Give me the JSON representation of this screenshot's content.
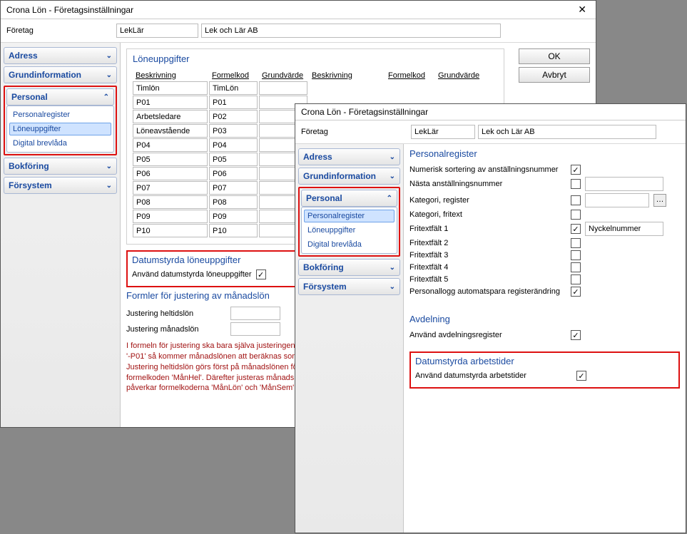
{
  "window_back": {
    "title": "Crona Lön - Företagsinställningar",
    "company_label": "Företag",
    "company_code": "LekLär",
    "company_name": "Lek och Lär AB",
    "buttons": {
      "ok": "OK",
      "cancel": "Avbryt"
    },
    "nav": {
      "adress": "Adress",
      "grundinformation": "Grundinformation",
      "personal": "Personal",
      "bokforing": "Bokföring",
      "forsystem": "Försystem",
      "personal_items": {
        "personalregister": "Personalregister",
        "loneuppgifter": "Löneuppgifter",
        "digital_brevlada": "Digital brevlåda"
      }
    },
    "lone_section": {
      "title": "Löneuppgifter",
      "headers": {
        "beskrivning": "Beskrivning",
        "formelkod": "Formelkod",
        "grundvarde": "Grundvärde"
      },
      "rows": [
        {
          "b": "Timlön",
          "f": "TimLön"
        },
        {
          "b": "P01",
          "f": "P01"
        },
        {
          "b": "Arbetsledare",
          "f": "P02"
        },
        {
          "b": "Löneavstående",
          "f": "P03"
        },
        {
          "b": "P04",
          "f": "P04"
        },
        {
          "b": "P05",
          "f": "P05"
        },
        {
          "b": "P06",
          "f": "P06"
        },
        {
          "b": "P07",
          "f": "P07"
        },
        {
          "b": "P08",
          "f": "P08"
        },
        {
          "b": "P09",
          "f": "P09"
        },
        {
          "b": "P10",
          "f": "P10"
        }
      ]
    },
    "datum_section": {
      "title": "Datumstyrda löneuppgifter",
      "checkbox_label": "Använd datumstyrda löneuppgifter"
    },
    "formler_section": {
      "title": "Formler för justering av månadslön",
      "row1": "Justering heltidslön",
      "row2": "Justering månadslön",
      "help": "I formeln för justering ska bara själva justeringen<br>'-P01' så kommer månadslönen att beräknas som p<br>Justering heltidslön görs först på månadslönen för<br>formelkoden 'MånHel'. Därefter justeras månadslö<br>påverkar formelkoderna 'MånLön' och 'MånSem'."
    }
  },
  "window_front": {
    "title": "Crona Lön - Företagsinställningar",
    "company_label": "Företag",
    "company_code": "LekLär",
    "company_name": "Lek och Lär AB",
    "nav": {
      "adress": "Adress",
      "grundinformation": "Grundinformation",
      "personal": "Personal",
      "bokforing": "Bokföring",
      "forsystem": "Försystem",
      "personal_items": {
        "personalregister": "Personalregister",
        "loneuppgifter": "Löneuppgifter",
        "digital_brevlada": "Digital brevlåda"
      }
    },
    "preg_section": {
      "title": "Personalregister",
      "rows": {
        "numerisk": "Numerisk sortering av anställningsnummer",
        "nasta": "Nästa anställningsnummer",
        "kategori_reg": "Kategori, register",
        "kategori_fri": "Kategori, fritext",
        "fritext1": "Fritextfält 1",
        "fritext2": "Fritextfält 2",
        "fritext3": "Fritextfält 3",
        "fritext4": "Fritextfält 4",
        "fritext5": "Fritextfält 5",
        "plogg": "Personallogg automatspara registerändring"
      },
      "fritext1_value": "Nyckelnummer"
    },
    "avd_section": {
      "title": "Avdelning",
      "row": "Använd avdelningsregister"
    },
    "datum_section": {
      "title": "Datumstyrda arbetstider",
      "row": "Använd datumstyrda arbetstider"
    }
  }
}
